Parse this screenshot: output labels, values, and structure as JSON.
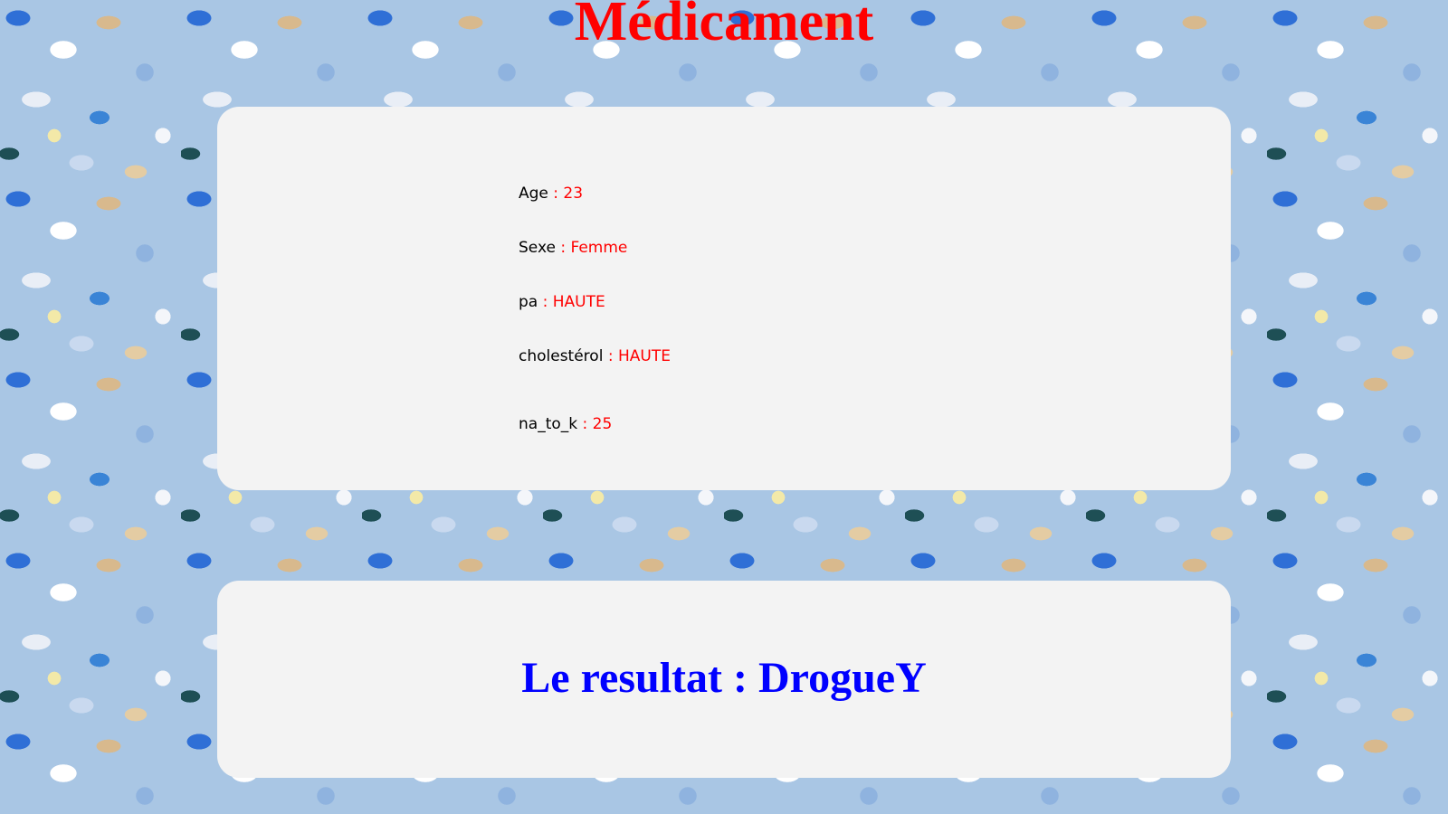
{
  "page": {
    "title": "Médicament"
  },
  "fields": [
    {
      "label": "Age",
      "value": ": 23"
    },
    {
      "label": "Sexe",
      "value": ": Femme"
    },
    {
      "label": "pa",
      "value": ": HAUTE"
    },
    {
      "label": "cholestérol",
      "value": ": HAUTE"
    },
    {
      "label": "na_to_k",
      "value": ": 25"
    }
  ],
  "result": {
    "label": "Le resultat",
    "separator": ":",
    "value": "DrogueY"
  },
  "colors": {
    "title": "#ff0000",
    "value": "#ff0000",
    "result": "#0000ff",
    "panel": "#f3f3f3"
  }
}
